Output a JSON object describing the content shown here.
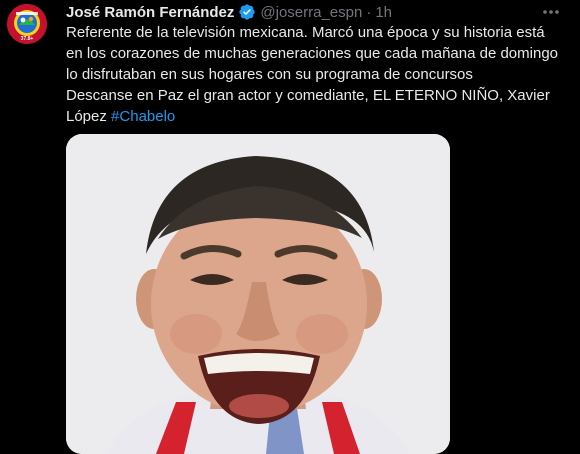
{
  "tweet": {
    "author_name": "José Ramón Fernández",
    "handle": "@joserra_espn",
    "separator": "·",
    "time": "1h",
    "text_lines": [
      "Referente de la televisión mexicana. Marcó una época y su historia está",
      "en los corazones de muchas generaciones que cada mañana de domingo",
      "lo disfrutaban en sus hogares con su programa de concursos",
      "Descanse en Paz el gran actor y comediante, EL ETERNO NIÑO,  Xavier"
    ],
    "last_line_prefix": "López ",
    "hashtag": "#Chabelo",
    "icons": {
      "verified": "verified-badge-icon",
      "more": "more-options-icon"
    }
  },
  "avatar": {
    "badge_text": "37.8+"
  },
  "colors": {
    "background": "#000000",
    "text": "#e7e9ea",
    "secondary": "#71767b",
    "link": "#1d9bf0",
    "avatar_red": "#c4122e"
  }
}
